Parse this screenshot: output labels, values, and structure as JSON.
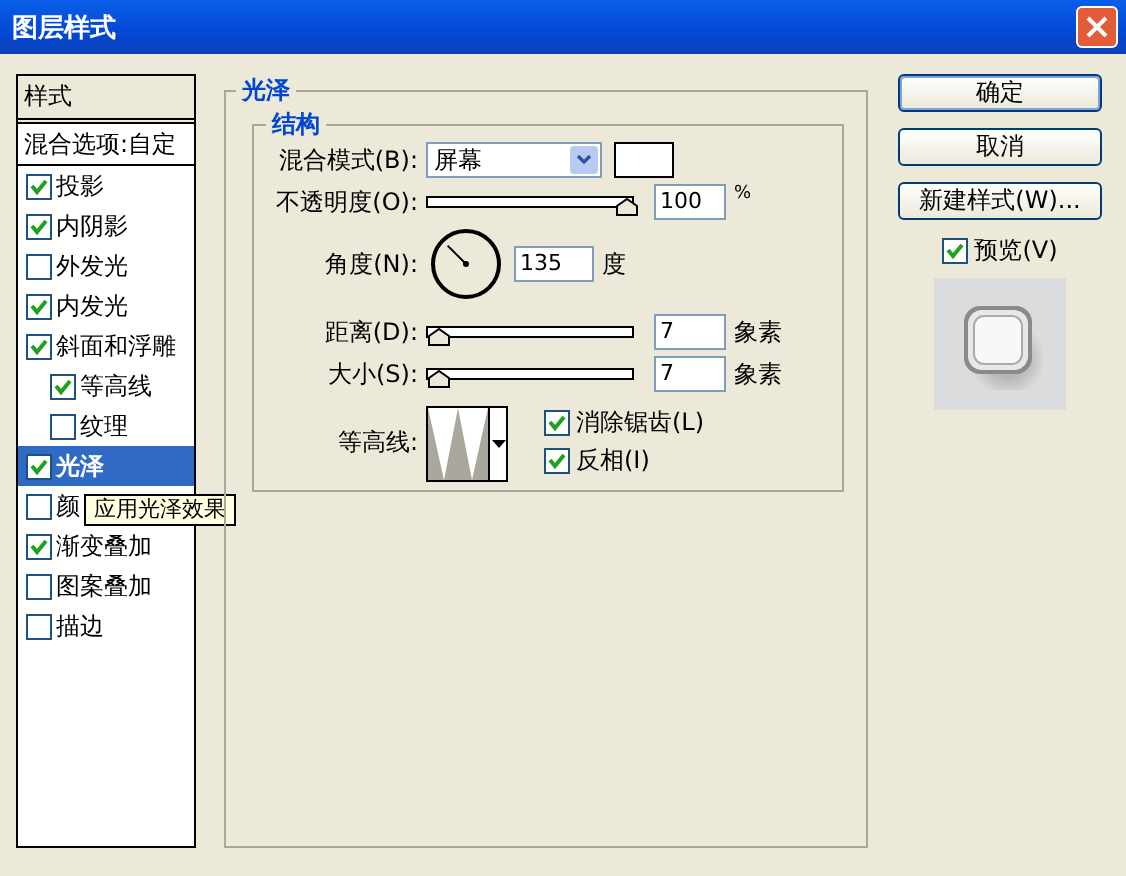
{
  "window": {
    "title": "图层样式"
  },
  "styles_list": {
    "header": "样式",
    "items": [
      {
        "label": "混合选项:自定",
        "kind": "blend",
        "selected": false
      },
      {
        "label": "投影",
        "kind": "effect",
        "checked": true,
        "selected": false
      },
      {
        "label": "内阴影",
        "kind": "effect",
        "checked": true,
        "selected": false
      },
      {
        "label": "外发光",
        "kind": "effect",
        "checked": false,
        "selected": false
      },
      {
        "label": "内发光",
        "kind": "effect",
        "checked": true,
        "selected": false
      },
      {
        "label": "斜面和浮雕",
        "kind": "effect",
        "checked": true,
        "selected": false,
        "children": [
          {
            "label": "等高线",
            "kind": "effect",
            "checked": true,
            "selected": false
          },
          {
            "label": "纹理",
            "kind": "effect",
            "checked": false,
            "selected": false
          }
        ]
      },
      {
        "label": "光泽",
        "kind": "effect",
        "checked": true,
        "selected": true
      },
      {
        "label": "颜",
        "kind": "effect",
        "checked": false,
        "selected": false
      },
      {
        "label": "渐变叠加",
        "kind": "effect",
        "checked": true,
        "selected": false
      },
      {
        "label": "图案叠加",
        "kind": "effect",
        "checked": false,
        "selected": false
      },
      {
        "label": "描边",
        "kind": "effect",
        "checked": false,
        "selected": false
      }
    ]
  },
  "tooltip": {
    "text": "应用光泽效果"
  },
  "panel": {
    "title": "光泽",
    "group_title": "结构",
    "blend_mode": {
      "label": "混合模式(B):",
      "value": "屏幕"
    },
    "opacity": {
      "label": "不透明度(O):",
      "level": 1.0,
      "value": "100",
      "unit": "%"
    },
    "angle": {
      "label": "角度(N):",
      "value": "135",
      "unit": "度"
    },
    "distance": {
      "label": "距离(D):",
      "level": 0.0,
      "value": "7",
      "unit": "象素"
    },
    "size": {
      "label": "大小(S):",
      "level": 0.0,
      "value": "7",
      "unit": "象素"
    },
    "contour": {
      "label": "等高线:"
    },
    "options": [
      {
        "label": "消除锯齿(L)",
        "checked": true
      },
      {
        "label": "反相(I)",
        "checked": true
      }
    ]
  },
  "buttons": [
    {
      "label": "确定",
      "default": true
    },
    {
      "label": "取消",
      "default": false
    },
    {
      "label": "新建样式(W)...",
      "default": false
    }
  ],
  "preview": {
    "label": "预览(V)",
    "checked": true
  }
}
